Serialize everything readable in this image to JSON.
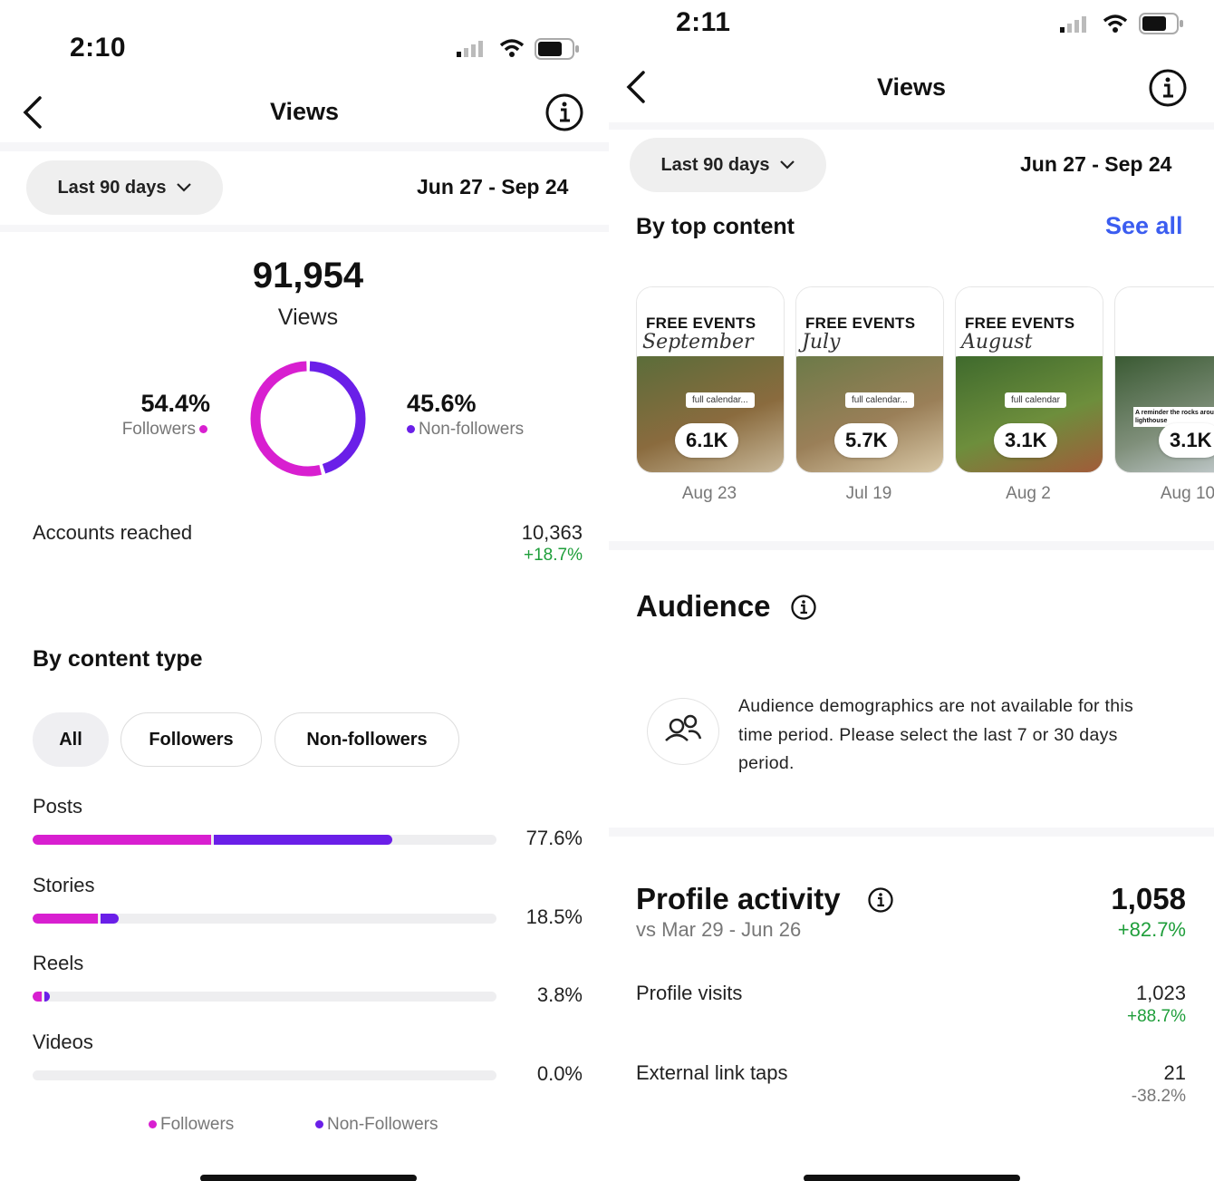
{
  "colors": {
    "followers": "#d81fd0",
    "non_followers": "#6a1fe8",
    "positive": "#1e9e3a",
    "link": "#3b5df0"
  },
  "left": {
    "time": "2:10",
    "title": "Views",
    "range_button": "Last 90 days",
    "date_range": "Jun 27 - Sep 24",
    "total_views": "91,954",
    "total_label": "Views",
    "followers_pct": "54.4%",
    "followers_label": "Followers",
    "non_followers_pct": "45.6%",
    "non_followers_label": "Non-followers",
    "donut": {
      "followers": 54.4,
      "non_followers": 45.6
    },
    "accounts_reached_label": "Accounts reached",
    "accounts_reached_value": "10,363",
    "accounts_reached_change": "+18.7%",
    "by_content_type": "By content type",
    "filters": [
      "All",
      "Followers",
      "Non-followers"
    ],
    "content_types": [
      {
        "label": "Posts",
        "pct": "77.6%",
        "followers": 38.5,
        "non_followers": 39.1
      },
      {
        "label": "Stories",
        "pct": "18.5%",
        "followers": 14.0,
        "non_followers": 4.5
      },
      {
        "label": "Reels",
        "pct": "3.8%",
        "followers": 1.9,
        "non_followers": 1.9
      },
      {
        "label": "Videos",
        "pct": "0.0%",
        "followers": 0,
        "non_followers": 0
      }
    ],
    "legend_followers": "Followers",
    "legend_non_followers": "Non-Followers"
  },
  "right": {
    "time": "2:11",
    "title": "Views",
    "range_button": "Last 90 days",
    "date_range": "Jun 27 - Sep 24",
    "by_top_content": "By top content",
    "see_all": "See all",
    "top_content": [
      {
        "heading": "FREE EVENTS",
        "script": "September",
        "cta": "full calendar...",
        "views": "6.1K",
        "date": "Aug 23"
      },
      {
        "heading": "FREE EVENTS",
        "script": "July",
        "cta": "full calendar...",
        "views": "5.7K",
        "date": "Jul 19"
      },
      {
        "heading": "FREE EVENTS",
        "script": "August",
        "cta": "full calendar",
        "views": "3.1K",
        "date": "Aug 2"
      },
      {
        "heading": "",
        "script": "",
        "cta": "A reminder the rocks around the lighthouse",
        "views": "3.1K",
        "date": "Aug 10"
      }
    ],
    "audience_title": "Audience",
    "audience_message": "Audience demographics are not available for this time period. Please select the last 7 or 30 days period.",
    "profile_activity_title": "Profile activity",
    "profile_activity_value": "1,058",
    "profile_activity_compare": "vs Mar 29 - Jun 26",
    "profile_activity_change": "+82.7%",
    "profile_visits_label": "Profile visits",
    "profile_visits_value": "1,023",
    "profile_visits_change": "+88.7%",
    "external_taps_label": "External link taps",
    "external_taps_value": "21",
    "external_taps_change": "-38.2%"
  }
}
